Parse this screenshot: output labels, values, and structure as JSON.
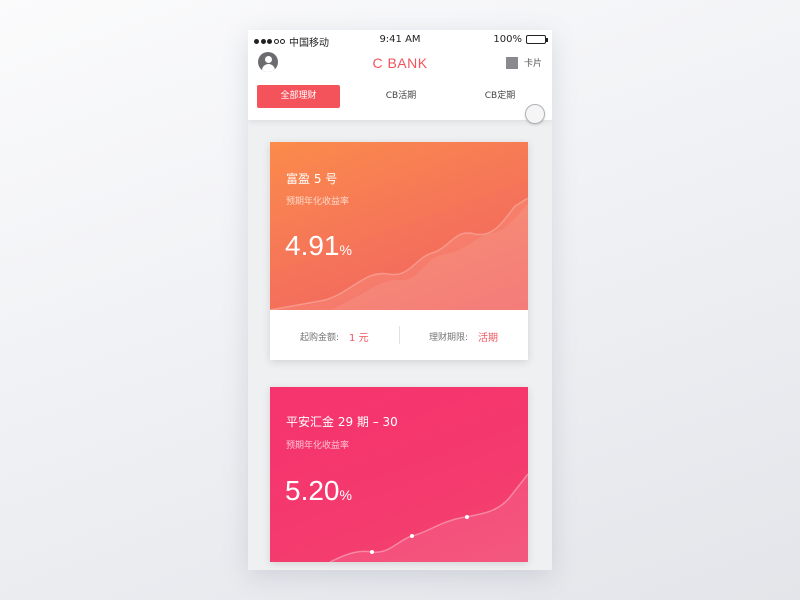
{
  "statusbar": {
    "carrier": "中国移动",
    "time": "9:41 AM",
    "battery": "100%"
  },
  "navbar": {
    "brand": "C BANK",
    "card_label": "卡片",
    "avatar_icon": "user-avatar-icon",
    "card_icon": "card-icon"
  },
  "tabs": [
    {
      "label": "全部理财",
      "active": true
    },
    {
      "label": "CB活期",
      "active": false
    },
    {
      "label": "CB定期",
      "active": false
    }
  ],
  "products": [
    {
      "name": "富盈 5 号",
      "subtitle": "预期年化收益率",
      "rate": "4.91",
      "rate_unit": "%",
      "min_label": "起购金额:",
      "min_value": "1 元",
      "term_label": "理财期限:",
      "term_value": "活期",
      "gradient": [
        "#fb8a4c",
        "#f3625e"
      ]
    },
    {
      "name": "平安汇金 29 期 – 30",
      "subtitle": "预期年化收益率",
      "rate": "5.20",
      "rate_unit": "%",
      "gradient": [
        "#f7336d",
        "#f4406e"
      ]
    }
  ],
  "colors": {
    "accent": "#f5535c",
    "brand": "#f0555d"
  }
}
